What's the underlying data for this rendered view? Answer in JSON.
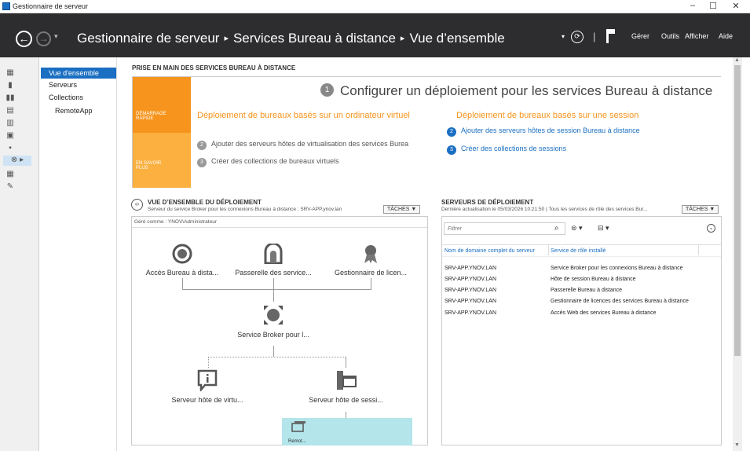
{
  "window": {
    "title": "Gestionnaire de serveur",
    "controls": [
      "–",
      "☐",
      "✕"
    ]
  },
  "header": {
    "breadcrumbs": [
      "Gestionnaire de serveur",
      "Services Bureau à distance",
      "Vue d’ensemble"
    ],
    "separator": "▸",
    "dropdown": "▾",
    "pipe": "|",
    "menu": [
      "Gérer",
      "Outils",
      "Afficher",
      "Aide"
    ]
  },
  "sidetree": {
    "items": [
      "Vue d'ensemble",
      "Serveurs",
      "Collections",
      "RemoteApp"
    ]
  },
  "quickstart": {
    "section_title": "PRISE EN MAIN DES SERVICES BUREAU À DISTANCE",
    "tab1": "DÉMARRAGE RAPIDE",
    "tab2": "EN SAVOIR PLUS",
    "main_num": "1",
    "main_title": "Configurer un déploiement pour les services Bureau à distance",
    "left_heading": "Déploiement de bureaux basés sur un ordinateur virtuel",
    "left_steps": [
      {
        "num": "2",
        "text": "Ajouter des serveurs hôtes de virtualisation des services Burea"
      },
      {
        "num": "3",
        "text": "Créer des collections de bureaux virtuels"
      }
    ],
    "right_heading": "Déploiement de bureaux basés sur une session",
    "right_steps": [
      {
        "num": "2",
        "text": "Ajouter des serveurs hôtes de session Bureau à distance"
      },
      {
        "num": "3",
        "text": "Créer des collections de sessions"
      }
    ]
  },
  "deployment": {
    "title": "VUE D’ENSEMBLE DU DÉPLOIEMENT",
    "subtitle": "Serveur du service Broker pour les connexions Bureau à distance : SRV-APP.ynov.lan",
    "tasks": "TÂCHES",
    "managed_as": "Géré comme : YNOV\\Administrateur",
    "nodes": {
      "access": "Accès Bureau à dista...",
      "gateway": "Passerelle des service...",
      "licensing": "Gestionnaire de licen...",
      "broker": "Service Broker pour l...",
      "virt": "Serveur hôte de virtu...",
      "session": "Serveur hôte de sessi...",
      "remote": "Remot..."
    }
  },
  "servers": {
    "title": "SERVEURS DE DÉPLOIEMENT",
    "subtitle": "Dernière actualisation le 05/03/2026 10:21:50 | Tous les services de rôle des services Bur...",
    "tasks": "TÂCHES",
    "filter_placeholder": "Filtrer",
    "columns": [
      "Nom de domaine complet du serveur",
      "Service de rôle installé"
    ],
    "rows": [
      [
        "SRV-APP.YNOV.LAN",
        "Service Broker pour les connexions Bureau à distance"
      ],
      [
        "SRV-APP.YNOV.LAN",
        "Hôte de session Bureau à distance"
      ],
      [
        "SRV-APP.YNOV.LAN",
        "Passerelle Bureau à distance"
      ],
      [
        "SRV-APP.YNOV.LAN",
        "Gestionnaire de licences des services Bureau à distance"
      ],
      [
        "SRV-APP.YNOV.LAN",
        "Accès Web des services Bureau à distance"
      ]
    ]
  }
}
